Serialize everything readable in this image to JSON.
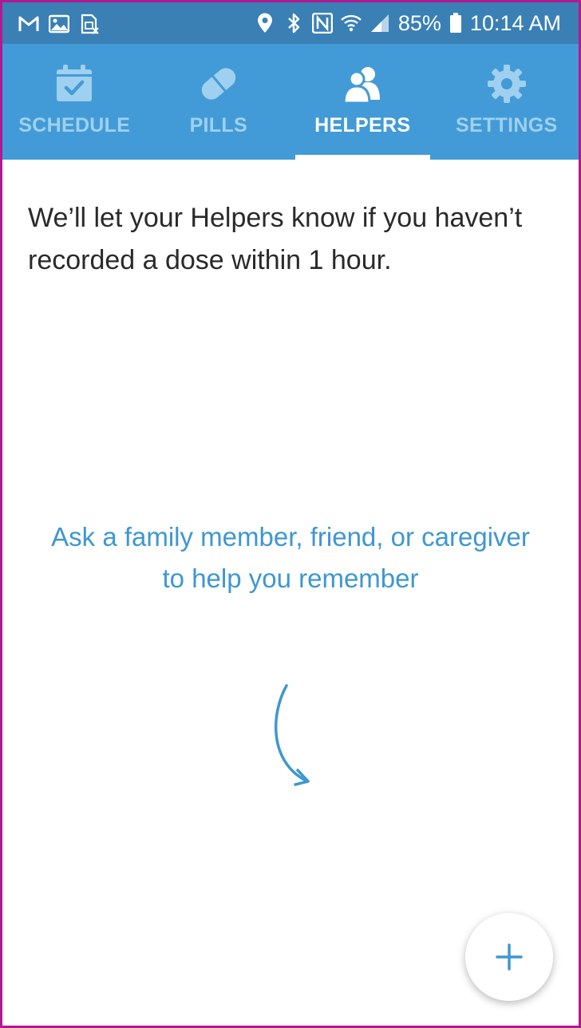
{
  "status_bar": {
    "battery": "85%",
    "time": "10:14 AM",
    "left_icons": [
      "gmail-icon",
      "gallery-icon",
      "sim-icon"
    ],
    "right_icons": [
      "location-icon",
      "bluetooth-icon",
      "nfc-icon",
      "wifi-icon",
      "signal-icon",
      "battery-icon"
    ]
  },
  "tabs": [
    {
      "label": "SCHEDULE",
      "icon": "calendar-check-icon",
      "active": false
    },
    {
      "label": "PILLS",
      "icon": "pill-icon",
      "active": false
    },
    {
      "label": "HELPERS",
      "icon": "people-icon",
      "active": true
    },
    {
      "label": "SETTINGS",
      "icon": "gear-icon",
      "active": false
    }
  ],
  "main": {
    "intro_text": "We’ll let your Helpers know if you haven’t recorded a dose within 1 hour.",
    "prompt_text": "Ask a family member, friend, or caregiver to help you remember"
  },
  "fab": {
    "icon": "plus-icon"
  },
  "colors": {
    "status_bar": "#3a80b5",
    "tab_bar": "#429bd6",
    "tab_inactive": "#9fd0f0",
    "accent": "#3e97d1",
    "frame_border": "#b0198f"
  }
}
